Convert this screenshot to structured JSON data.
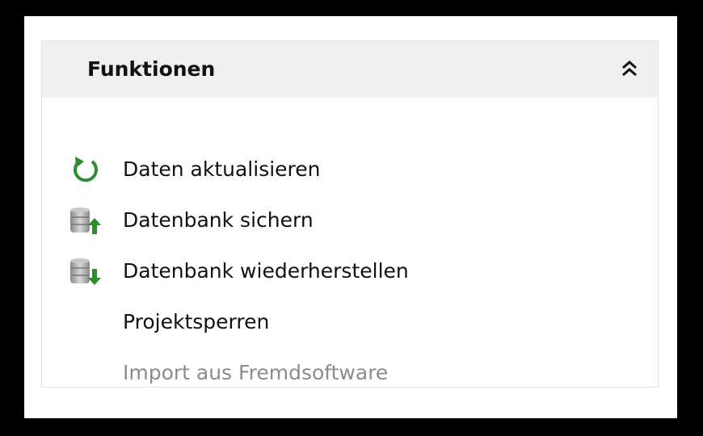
{
  "panel": {
    "title": "Funktionen",
    "collapse_icon": "double-chevron-up-icon",
    "items": [
      {
        "label": "Daten aktualisieren",
        "icon": "refresh-icon",
        "enabled": true
      },
      {
        "label": "Datenbank sichern",
        "icon": "database-backup-icon",
        "enabled": true
      },
      {
        "label": "Datenbank wiederherstellen",
        "icon": "database-restore-icon",
        "enabled": true
      },
      {
        "label": "Projektsperren",
        "icon": "",
        "enabled": true
      },
      {
        "label": "Import aus Fremdsoftware",
        "icon": "",
        "enabled": false
      }
    ]
  },
  "colors": {
    "header_bg": "#efefef",
    "accent_green": "#2e8b2e",
    "disabled_text": "#8c8c8c"
  }
}
